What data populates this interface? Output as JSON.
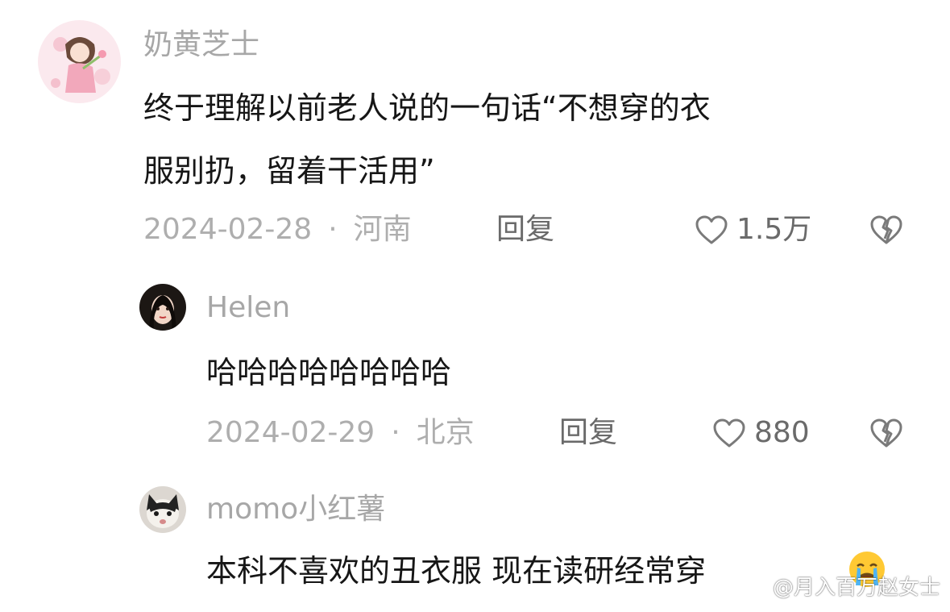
{
  "comments": [
    {
      "username": "奶黄芝士",
      "text_line1": "终于理解以前老人说的一句话“不想穿的衣",
      "text_line2": "服别扔，留着干活用”",
      "date": "2024-02-28",
      "location": "河南",
      "reply_label": "回复",
      "likes": "1.5万"
    },
    {
      "username": "Helen",
      "text_line1": "哈哈哈哈哈哈哈哈",
      "date": "2024-02-29",
      "location": "北京",
      "reply_label": "回复",
      "likes": "880"
    },
    {
      "username": "momo小红薯",
      "text_line1": "本科不喜欢的丑衣服 现在读研经常穿"
    }
  ],
  "separator": "·",
  "icons": {
    "like": "heart-outline-icon",
    "dislike": "broken-heart-icon",
    "emoji": "crying-face-emoji"
  },
  "watermark": "@月入百万赵女士",
  "colors": {
    "username": "#a7a7a7",
    "text": "#161616",
    "meta": "#aeaeae",
    "action": "#6a6a6a"
  }
}
